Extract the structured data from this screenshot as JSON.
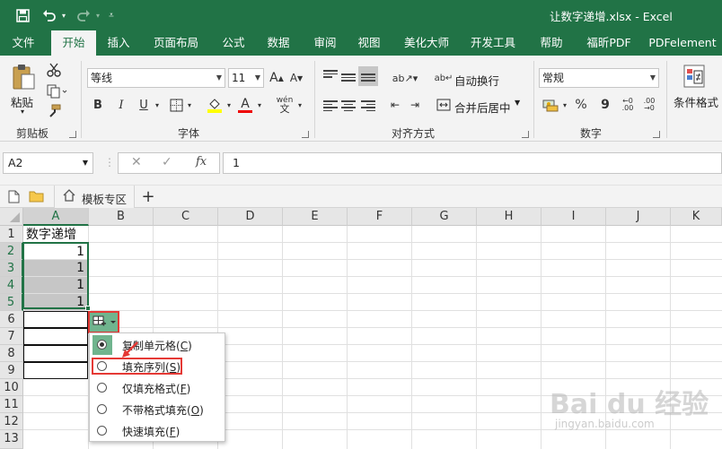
{
  "window": {
    "title": "让数字递增.xlsx  -  Excel"
  },
  "quick_access": {
    "save_icon": "save-icon",
    "undo_icon": "undo-icon",
    "redo_icon": "redo-icon",
    "customize_icon": "customize-icon"
  },
  "ribbon_tabs": [
    "文件",
    "开始",
    "插入",
    "页面布局",
    "公式",
    "数据",
    "审阅",
    "视图",
    "美化大师",
    "开发工具",
    "帮助",
    "福昕PDF",
    "PDFelement"
  ],
  "active_tab": "开始",
  "clipboard": {
    "paste_label": "粘贴",
    "group_label": "剪贴板"
  },
  "font": {
    "name": "等线",
    "size": "11",
    "group_label": "字体",
    "bold": "B",
    "italic": "I",
    "underline": "U",
    "grow": "A",
    "shrink": "A",
    "font_color": "A",
    "phonetic": "wén"
  },
  "alignment": {
    "wrap_label": "自动换行",
    "merge_label": "合并后居中",
    "group_label": "对齐方式"
  },
  "number": {
    "format": "常规",
    "group_label": "数字",
    "percent": "%",
    "comma": "9"
  },
  "styles": {
    "conditional_label": "条件格式"
  },
  "formula_bar": {
    "name_box": "A2",
    "fx": "fx",
    "value": "1"
  },
  "sheet_strip": {
    "template_tab": "模板专区",
    "add": "+"
  },
  "columns": [
    "A",
    "B",
    "C",
    "D",
    "E",
    "F",
    "G",
    "H",
    "I",
    "J",
    "K"
  ],
  "rows": [
    "1",
    "2",
    "3",
    "4",
    "5",
    "6",
    "7",
    "8",
    "9",
    "10",
    "11",
    "12",
    "13"
  ],
  "cells": {
    "A1": "数字递增",
    "A2": "1",
    "A3": "1",
    "A4": "1",
    "A5": "1"
  },
  "autofill_menu": {
    "items": [
      {
        "label": "复制单元格",
        "key": "C",
        "selected": true
      },
      {
        "label": "填充序列",
        "key": "S",
        "selected": false
      },
      {
        "label": "仅填充格式",
        "key": "F",
        "selected": false
      },
      {
        "label": "不带格式填充",
        "key": "O",
        "selected": false
      },
      {
        "label": "快速填充",
        "key": "F",
        "selected": false
      }
    ]
  },
  "watermark": {
    "main": "Bai du 经验",
    "sub": "jingyan.baidu.com"
  },
  "colors": {
    "excel_green": "#217346",
    "highlight_red": "#e53935",
    "selection_gray": "#c6c6c6"
  }
}
